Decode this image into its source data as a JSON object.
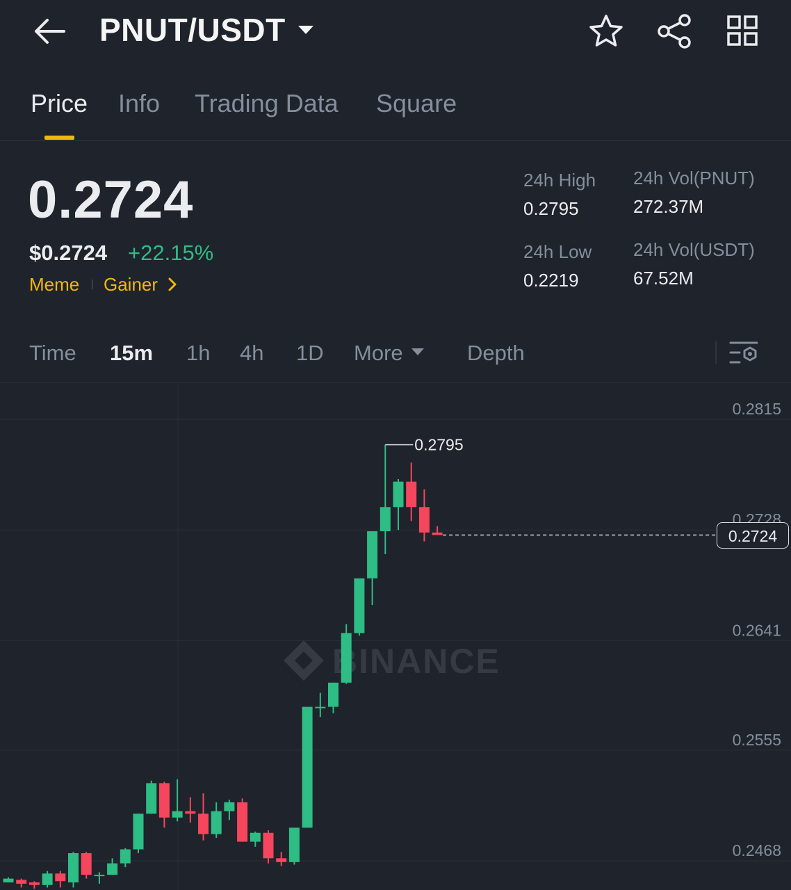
{
  "header": {
    "pair": "PNUT/USDT"
  },
  "tabs": [
    {
      "label": "Price",
      "active": true
    },
    {
      "label": "Info",
      "active": false
    },
    {
      "label": "Trading Data",
      "active": false
    },
    {
      "label": "Square",
      "active": false
    }
  ],
  "price": {
    "last": "0.2724",
    "usd": "$0.2724",
    "change": "+22.15%",
    "tags": [
      "Meme",
      "Gainer"
    ]
  },
  "stats": {
    "high_label": "24h High",
    "high": "0.2795",
    "low_label": "24h Low",
    "low": "0.2219",
    "vol_base_label": "24h Vol(PNUT)",
    "vol_base": "272.37M",
    "vol_quote_label": "24h Vol(USDT)",
    "vol_quote": "67.52M"
  },
  "timeframes": {
    "items": [
      "Time",
      "15m",
      "1h",
      "4h",
      "1D"
    ],
    "active": "15m",
    "more": "More",
    "depth": "Depth"
  },
  "colors": {
    "up": "#2ebd85",
    "down": "#f6465d",
    "accent": "#f0b90b",
    "background": "#1f232b"
  },
  "chart_data": {
    "type": "candlestick",
    "watermark": "BINANCE",
    "y_ticks": [
      "0.2815",
      "0.2728",
      "0.2641",
      "0.2555",
      "0.2468"
    ],
    "ylim": [
      0.2451,
      0.2835
    ],
    "high_marker": "0.2795",
    "last_price": "0.2724",
    "candles": [
      {
        "o": 0.2451,
        "h": 0.2455,
        "l": 0.2451,
        "c": 0.2454
      },
      {
        "o": 0.2453,
        "h": 0.2454,
        "l": 0.2447,
        "c": 0.245
      },
      {
        "o": 0.2451,
        "h": 0.2452,
        "l": 0.2446,
        "c": 0.2449
      },
      {
        "o": 0.2449,
        "h": 0.246,
        "l": 0.2447,
        "c": 0.2458
      },
      {
        "o": 0.2458,
        "h": 0.246,
        "l": 0.2447,
        "c": 0.2452
      },
      {
        "o": 0.2451,
        "h": 0.2475,
        "l": 0.2447,
        "c": 0.2474
      },
      {
        "o": 0.2474,
        "h": 0.2475,
        "l": 0.2454,
        "c": 0.2457
      },
      {
        "o": 0.2457,
        "h": 0.2459,
        "l": 0.245,
        "c": 0.2457
      },
      {
        "o": 0.2457,
        "h": 0.247,
        "l": 0.2457,
        "c": 0.2466
      },
      {
        "o": 0.2466,
        "h": 0.2478,
        "l": 0.2463,
        "c": 0.2477
      },
      {
        "o": 0.2477,
        "h": 0.2505,
        "l": 0.2474,
        "c": 0.2505
      },
      {
        "o": 0.2505,
        "h": 0.2531,
        "l": 0.2505,
        "c": 0.2529
      },
      {
        "o": 0.2529,
        "h": 0.253,
        "l": 0.2494,
        "c": 0.2502
      },
      {
        "o": 0.2502,
        "h": 0.2532,
        "l": 0.2499,
        "c": 0.2507
      },
      {
        "o": 0.2507,
        "h": 0.2518,
        "l": 0.2498,
        "c": 0.2505
      },
      {
        "o": 0.2505,
        "h": 0.2521,
        "l": 0.2484,
        "c": 0.2489
      },
      {
        "o": 0.2489,
        "h": 0.2514,
        "l": 0.2486,
        "c": 0.2507
      },
      {
        "o": 0.2507,
        "h": 0.2516,
        "l": 0.25,
        "c": 0.2514
      },
      {
        "o": 0.2514,
        "h": 0.2517,
        "l": 0.2483,
        "c": 0.2483
      },
      {
        "o": 0.2483,
        "h": 0.2491,
        "l": 0.2479,
        "c": 0.249
      },
      {
        "o": 0.249,
        "h": 0.2492,
        "l": 0.2466,
        "c": 0.247
      },
      {
        "o": 0.247,
        "h": 0.2475,
        "l": 0.2464,
        "c": 0.2467
      },
      {
        "o": 0.2467,
        "h": 0.2494,
        "l": 0.2465,
        "c": 0.2494
      },
      {
        "o": 0.2494,
        "h": 0.2586,
        "l": 0.2494,
        "c": 0.2589
      },
      {
        "o": 0.2589,
        "h": 0.26,
        "l": 0.2581,
        "c": 0.2589
      },
      {
        "o": 0.2589,
        "h": 0.2608,
        "l": 0.2584,
        "c": 0.2608
      },
      {
        "o": 0.2608,
        "h": 0.2654,
        "l": 0.2607,
        "c": 0.2647
      },
      {
        "o": 0.2647,
        "h": 0.2686,
        "l": 0.2645,
        "c": 0.269
      },
      {
        "o": 0.269,
        "h": 0.2721,
        "l": 0.2669,
        "c": 0.2727
      },
      {
        "o": 0.2727,
        "h": 0.2795,
        "l": 0.2709,
        "c": 0.2746
      },
      {
        "o": 0.2746,
        "h": 0.2768,
        "l": 0.2728,
        "c": 0.2766
      },
      {
        "o": 0.2766,
        "h": 0.2781,
        "l": 0.2735,
        "c": 0.2746
      },
      {
        "o": 0.2746,
        "h": 0.276,
        "l": 0.2719,
        "c": 0.2726
      },
      {
        "o": 0.2726,
        "h": 0.2731,
        "l": 0.2724,
        "c": 0.2724
      }
    ]
  }
}
